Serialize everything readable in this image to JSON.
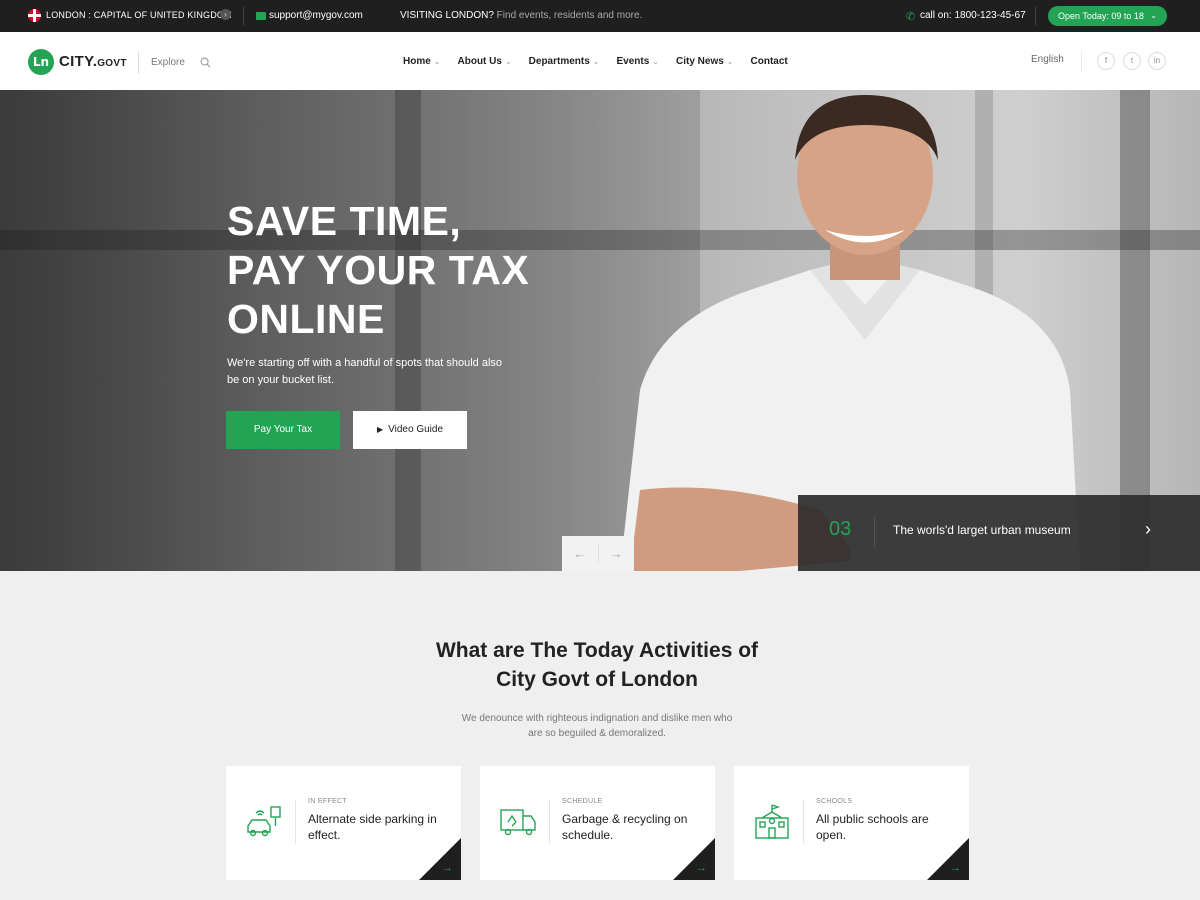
{
  "topbar": {
    "location": "LONDON : CAPITAL OF UNITED KINGDOM",
    "email": "support@mygov.com",
    "visit_strong": "VISITING LONDON?",
    "visit_rest": " Find events, residents and more.",
    "phone": "call on: 1800-123-45-67",
    "open_label": "Open Today: 09 to 18"
  },
  "header": {
    "logo_mark": "Ln",
    "logo_main": "CITY.",
    "logo_small": "GOVT",
    "explore": "Explore",
    "nav": [
      "Home",
      "About Us",
      "Departments",
      "Events",
      "City News",
      "Contact"
    ],
    "language": "English",
    "social": [
      "f",
      "t",
      "in"
    ]
  },
  "hero": {
    "title_line1": "SAVE TIME,",
    "title_line2": "PAY YOUR TAX",
    "title_line3": "ONLINE",
    "subtitle": "We're starting off with a handful of spots that should also be on your bucket list.",
    "pay_button": "Pay Your Tax",
    "video_button": "Video Guide",
    "slide_number": "03",
    "slide_caption": "The worls'd larget urban museum"
  },
  "activities": {
    "title_line1": "What are The Today Activities of",
    "title_line2": "City Govt of London",
    "subtitle_line1": "We denounce with righteous indignation and dislike men who",
    "subtitle_line2": "are so beguiled & demoralized.",
    "cards": [
      {
        "category": "IN EFFECT",
        "text": "Alternate side parking in effect.",
        "icon": "parking-car-icon"
      },
      {
        "category": "SCHEDULE",
        "text": "Garbage & recycling on schedule.",
        "icon": "recycling-truck-icon"
      },
      {
        "category": "SCHOOLS",
        "text": "All public schools are open.",
        "icon": "school-building-icon"
      }
    ]
  },
  "colors": {
    "accent": "#23a455",
    "topbar_bg": "#1f1f1f",
    "section_bg": "#efefef"
  }
}
